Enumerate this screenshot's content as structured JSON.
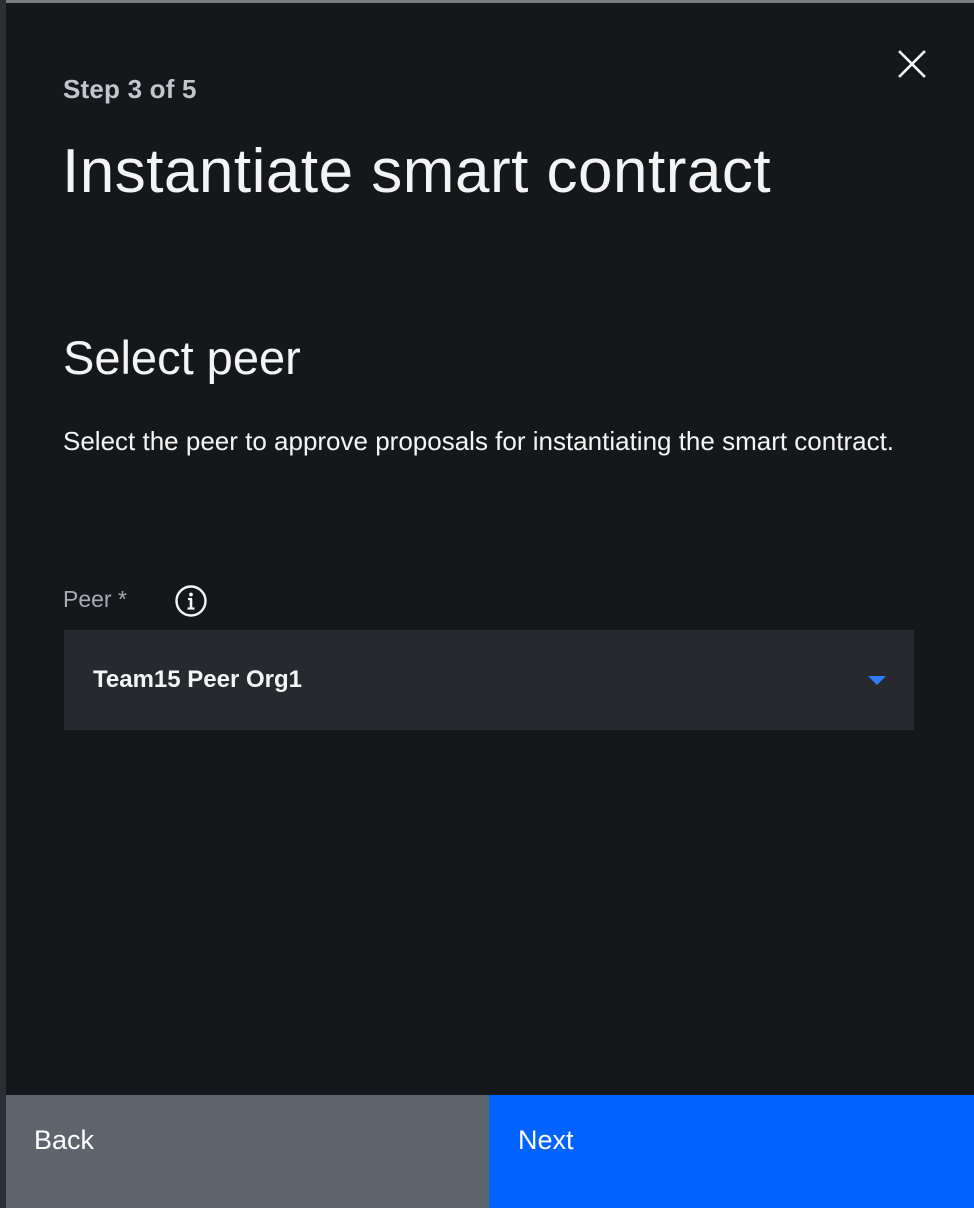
{
  "header": {
    "step": "Step 3 of 5",
    "title": "Instantiate smart contract",
    "close_icon": "close-icon"
  },
  "section": {
    "title": "Select peer",
    "description": "Select the peer to approve proposals for instantiating the smart contract."
  },
  "peer_field": {
    "label": "Peer *",
    "info_icon": "info-icon",
    "selected_value": "Team15 Peer Org1",
    "caret_icon": "caret-down-icon"
  },
  "footer": {
    "back_label": "Back",
    "next_label": "Next"
  },
  "colors": {
    "panel_background": "#15181b",
    "select_background": "#262a2f",
    "primary_button": "#0062ff",
    "secondary_button": "#5d646b",
    "caret": "#2f7bff",
    "text_primary": "#f4f4f4",
    "text_secondary": "#a7abb0"
  }
}
